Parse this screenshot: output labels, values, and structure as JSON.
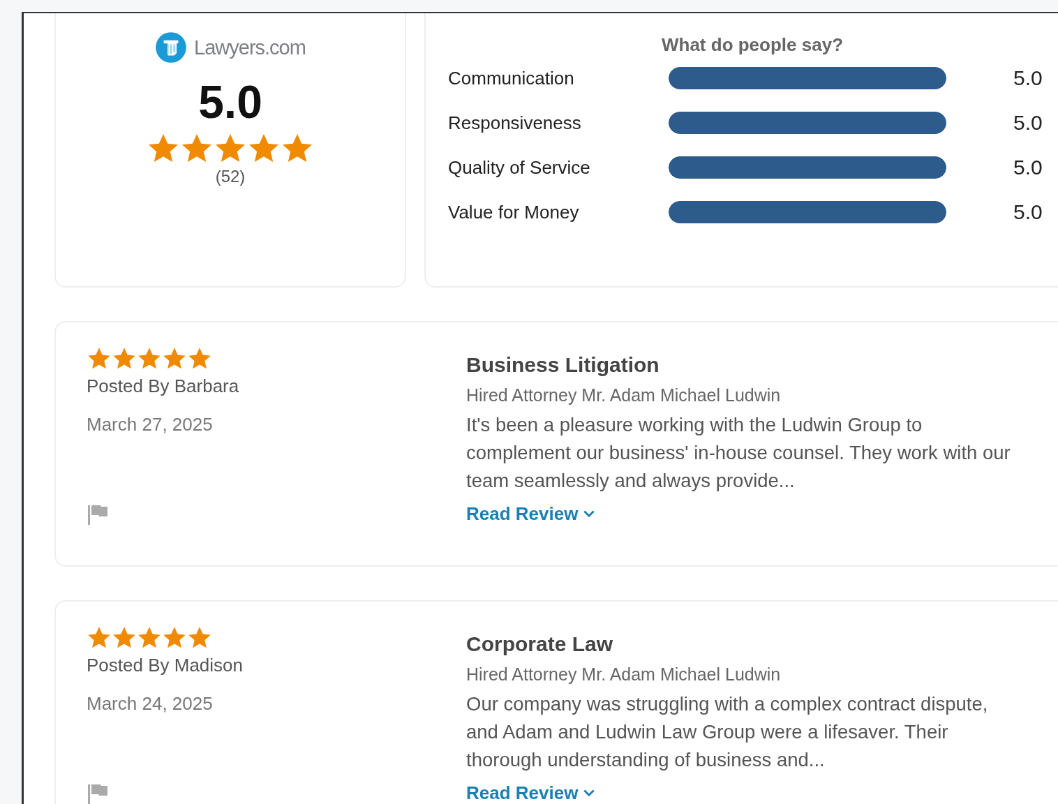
{
  "summary": {
    "logo_text": "Lawyers.com",
    "score": "5.0",
    "stars": 5,
    "count": "(52)"
  },
  "ratings": {
    "title": "What do people say?",
    "items": [
      {
        "label": "Communication",
        "level": 1,
        "reading": "5.0"
      },
      {
        "label": "Responsiveness",
        "level": 1,
        "reading": "5.0"
      },
      {
        "label": "Quality of Service",
        "level": 1,
        "reading": "5.0"
      },
      {
        "label": "Value for Money",
        "level": 1,
        "reading": "5.0"
      }
    ]
  },
  "reviews": [
    {
      "stars": 5,
      "author": "Posted By Barbara",
      "date": "March 27, 2025",
      "title": "Business Litigation",
      "attorney": "Hired Attorney Mr. Adam Michael Ludwin",
      "text": "It's been a pleasure working with the Ludwin Group to complement our business' in-house counsel. They work with our team seamlessly and always provide...",
      "link": "Read Review"
    },
    {
      "stars": 5,
      "author": "Posted By Madison",
      "date": "March 24, 2025",
      "title": "Corporate Law",
      "attorney": "Hired Attorney Mr. Adam Michael Ludwin",
      "text": "Our company was struggling with a complex contract dispute, and Adam and Ludwin Law Group were a lifesaver. Their thorough understanding of business and...",
      "link": "Read Review"
    }
  ]
}
